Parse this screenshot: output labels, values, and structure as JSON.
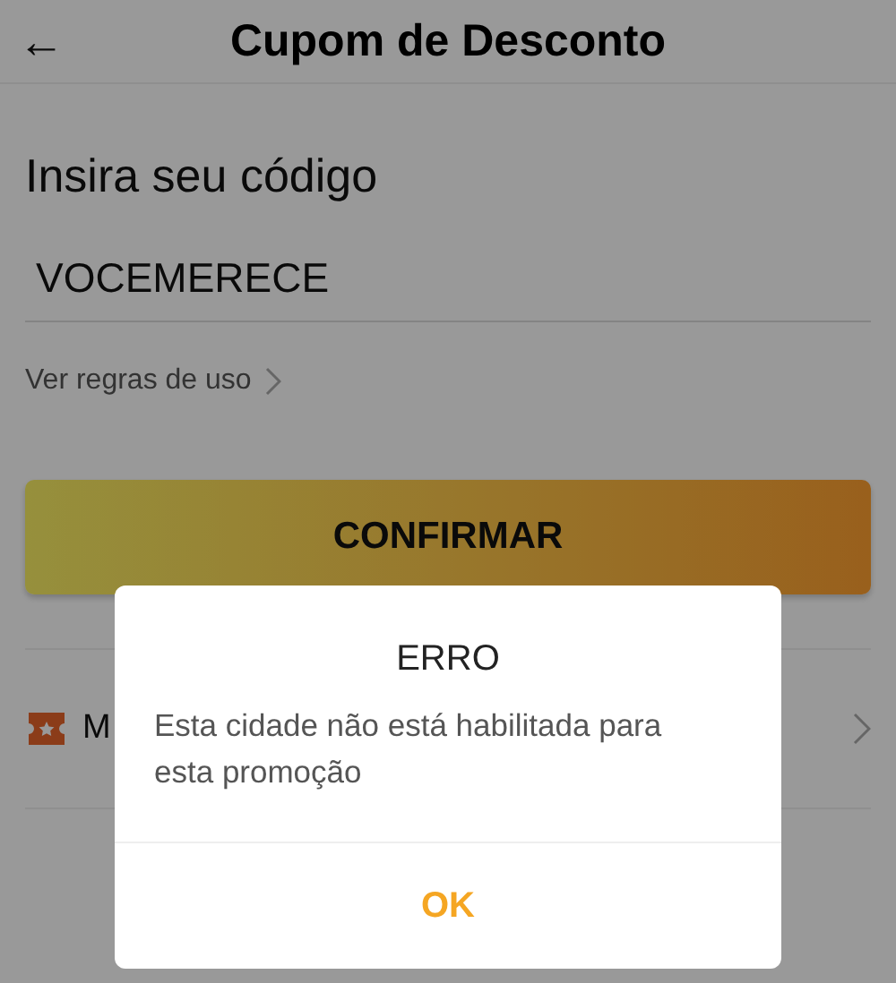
{
  "header": {
    "back_icon": "←",
    "title": "Cupom de Desconto"
  },
  "form": {
    "label": "Insira seu código",
    "value": "VOCEMERECE",
    "rules_link": "Ver regras de uso",
    "confirm_button": "CONFIRMAR"
  },
  "list_row": {
    "label": "M"
  },
  "dialog": {
    "title": "ERRO",
    "message": "Esta cidade não está habilitada para esta promoção",
    "ok_button": "OK"
  }
}
